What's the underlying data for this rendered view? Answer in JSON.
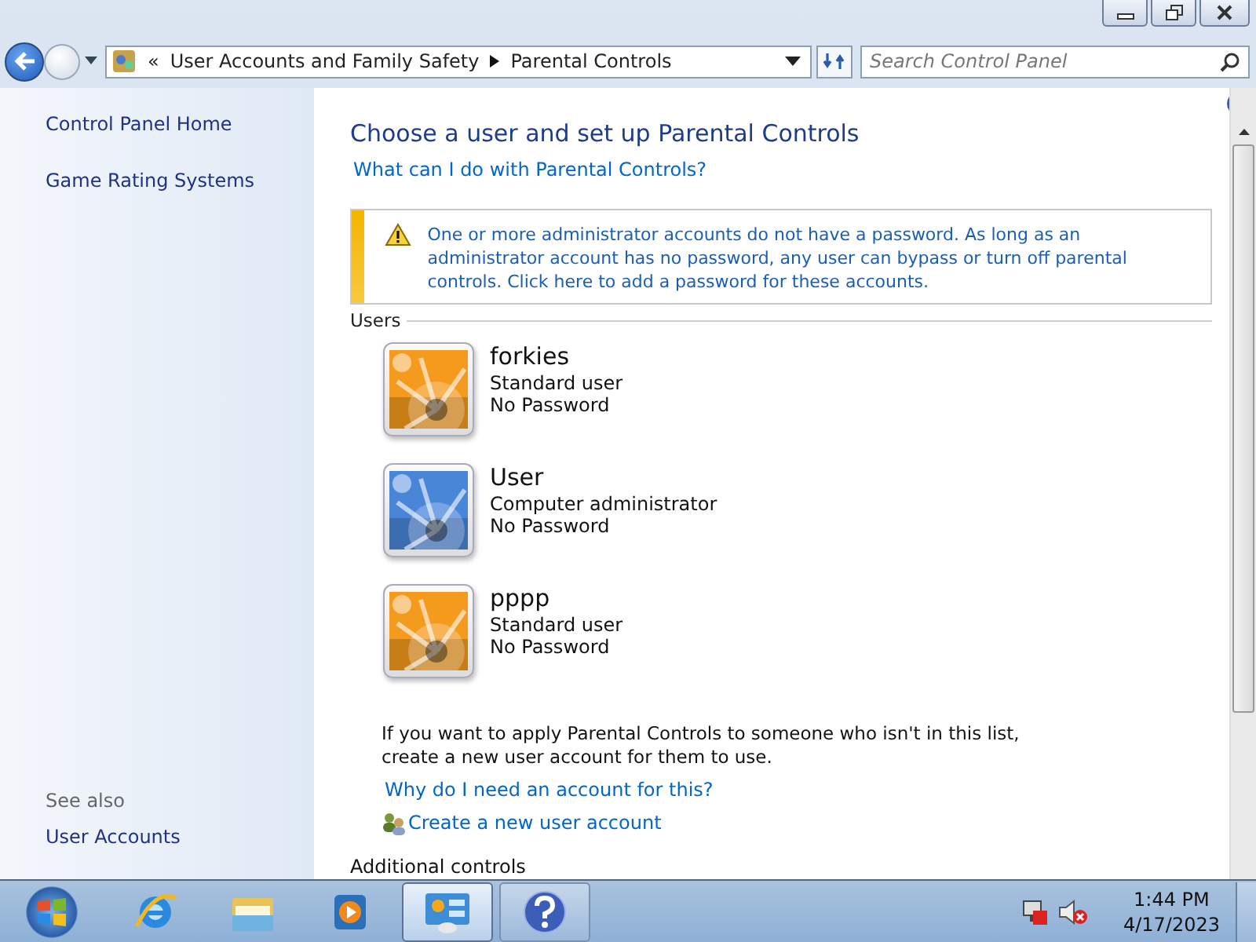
{
  "address_bar": {
    "breadcrumbs": [
      "User Accounts and Family Safety",
      "Parental Controls"
    ],
    "overflow": "«",
    "search": {
      "placeholder": "Search Control Panel"
    }
  },
  "sidebar": {
    "items": [
      {
        "label": "Control Panel Home"
      },
      {
        "label": "Game Rating Systems"
      }
    ],
    "see_also": {
      "heading": "See also",
      "items": [
        {
          "label": "User Accounts"
        }
      ]
    }
  },
  "main": {
    "title": "Choose a user and set up Parental Controls",
    "help_link": "What can I do with Parental Controls?",
    "warning": "One or more administrator accounts do not have a password. As long as an administrator account has no password, any user can bypass or turn off parental controls. Click here to add a password for these accounts.",
    "users_heading": "Users",
    "users": [
      {
        "name": "forkies",
        "type": "Standard user",
        "password": "No Password",
        "color": "#f49a1c"
      },
      {
        "name": "User",
        "type": "Computer administrator",
        "password": "No Password",
        "color": "#4a86d8"
      },
      {
        "name": "pppp",
        "type": "Standard user",
        "password": "No Password",
        "color": "#f49a1c"
      }
    ],
    "note": "If you want to apply Parental Controls to someone who isn't in this list, create a new user account for them to use.",
    "why_link": "Why do I need an account for this?",
    "create_link": "Create a new user account",
    "additional_heading": "Additional controls"
  },
  "taskbar": {
    "items": [
      {
        "kind": "ie",
        "selected": false
      },
      {
        "kind": "folder",
        "selected": false
      },
      {
        "kind": "media",
        "selected": false
      },
      {
        "kind": "control",
        "selected": true
      },
      {
        "kind": "help",
        "selected": false
      }
    ],
    "time": "1:44 PM",
    "date": "4/17/2023"
  }
}
